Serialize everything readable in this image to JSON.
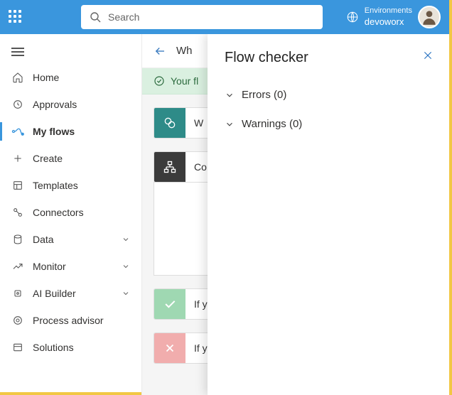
{
  "header": {
    "search_placeholder": "Search",
    "env_label": "Environments",
    "env_name": "devoworx"
  },
  "sidebar": {
    "items": [
      {
        "label": "Home"
      },
      {
        "label": "Approvals"
      },
      {
        "label": "My flows"
      },
      {
        "label": "Create"
      },
      {
        "label": "Templates"
      },
      {
        "label": "Connectors"
      },
      {
        "label": "Data"
      },
      {
        "label": "Monitor"
      },
      {
        "label": "AI Builder"
      },
      {
        "label": "Process advisor"
      },
      {
        "label": "Solutions"
      }
    ]
  },
  "breadcrumb": {
    "title": "Wh"
  },
  "success_msg": "Your fl",
  "steps": {
    "trigger_label": "W",
    "condition_label": "Co",
    "yes_label": "If y",
    "no_label": "If y"
  },
  "panel": {
    "title": "Flow checker",
    "errors_label": "Errors (0)",
    "warnings_label": "Warnings (0)"
  }
}
